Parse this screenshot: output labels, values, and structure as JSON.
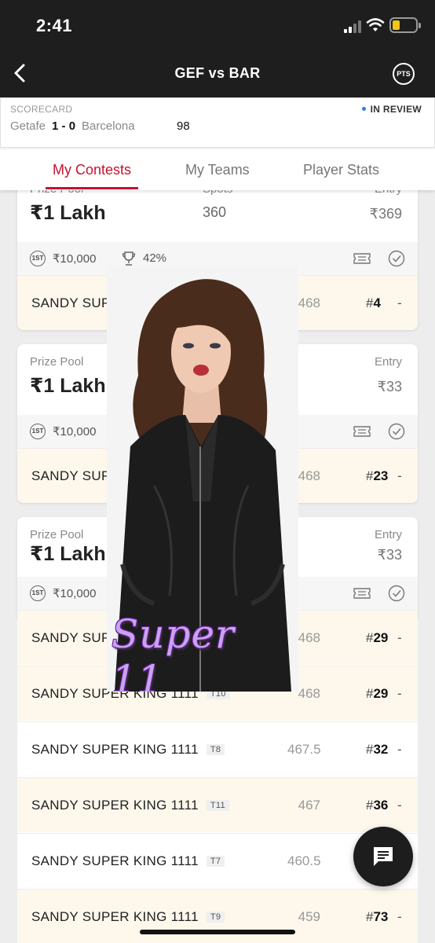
{
  "status_bar": {
    "time": "2:41"
  },
  "header": {
    "title": "GEF vs BAR",
    "pts_label": "PTS"
  },
  "scorecard": {
    "label": "SCORECARD",
    "status": "IN REVIEW",
    "home_team": "Getafe",
    "score": "1 - 0",
    "away_team": "Barcelona",
    "points": "98"
  },
  "tabs": [
    {
      "label": "My Contests",
      "active": true
    },
    {
      "label": "My Teams",
      "active": false
    },
    {
      "label": "Player Stats",
      "active": false
    }
  ],
  "contests": [
    {
      "prize_pool_label": "Prize Pool",
      "prize_pool": "₹1 Lakh",
      "spots_label": "Spots",
      "spots": "360",
      "entry_label": "Entry",
      "entry": "₹369",
      "first_badge": "1ST",
      "first_prize": "₹10,000",
      "win_percent": "42%",
      "teams": [
        {
          "name": "SANDY SUPER KING 1111",
          "points": "468",
          "rank": "4",
          "dash": "-"
        }
      ]
    },
    {
      "prize_pool_label": "Prize Pool",
      "prize_pool": "₹1 Lakh",
      "entry_label": "Entry",
      "entry": "₹33",
      "first_badge": "1ST",
      "first_prize": "₹10,000",
      "teams": [
        {
          "name": "SANDY SUPER KING 1111",
          "points": "468",
          "rank": "23",
          "dash": "-"
        }
      ]
    },
    {
      "prize_pool_label": "Prize Pool",
      "prize_pool": "₹1 Lakh",
      "entry_label": "Entry",
      "entry": "₹33",
      "first_badge": "1ST",
      "first_prize": "₹10,000",
      "teams": [
        {
          "name": "SANDY SUPER KING 1111",
          "tag": "",
          "points": "468",
          "rank": "29",
          "dash": "-"
        },
        {
          "name": "SANDY SUPER KING 1111",
          "tag": "T10",
          "points": "468",
          "rank": "29",
          "dash": "-"
        },
        {
          "name": "SANDY SUPER KING 1111",
          "tag": "T8",
          "points": "467.5",
          "rank": "32",
          "dash": "-"
        },
        {
          "name": "SANDY SUPER KING 1111",
          "tag": "T11",
          "points": "467",
          "rank": "36",
          "dash": "-"
        },
        {
          "name": "SANDY SUPER KING 1111",
          "tag": "T7",
          "points": "460.5",
          "rank": "",
          "dash": ""
        },
        {
          "name": "SANDY SUPER KING 1111",
          "tag": "T9",
          "points": "459",
          "rank": "73",
          "dash": "-"
        }
      ]
    }
  ],
  "overlay": {
    "caption": "Super 11"
  },
  "colors": {
    "accent": "#c8102e",
    "header_bg": "#1e1e1e",
    "row_bg": "#fdf7ec",
    "caption": "#c9a3ec"
  }
}
